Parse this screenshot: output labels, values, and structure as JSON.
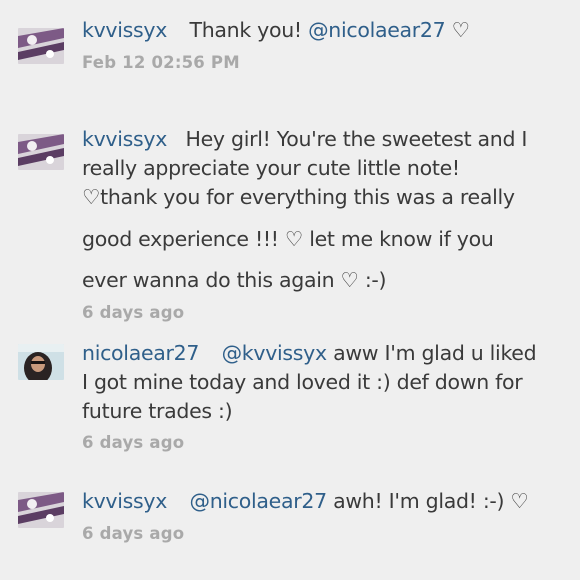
{
  "comments": [
    {
      "username": "kvvissyx",
      "lines": [
        [
          "Thank you! ",
          "@nicolaear27",
          " ♡"
        ]
      ],
      "time": "Feb 12 02:56 PM"
    },
    {
      "username": "kvvissyx",
      "lines": [
        "Hey girl! You're the sweetest and I",
        "really appreciate your cute little note!",
        "♡thank you for everything this was a really",
        "good experience !!! ♡ let me know if you",
        "ever wanna do this again ♡ :-)"
      ],
      "time": "6 days ago"
    },
    {
      "username": "nicolaear27",
      "mention": "@kvvissyx",
      "lines": [
        "aww I'm glad u liked",
        "I got mine today and loved it :) def down for",
        "future trades :)"
      ],
      "time": "6 days ago"
    },
    {
      "username": "kvvissyx",
      "mention": "@nicolaear27",
      "lines": [
        "awh! I'm glad! :-) ♡"
      ],
      "time": "6 days ago"
    }
  ]
}
